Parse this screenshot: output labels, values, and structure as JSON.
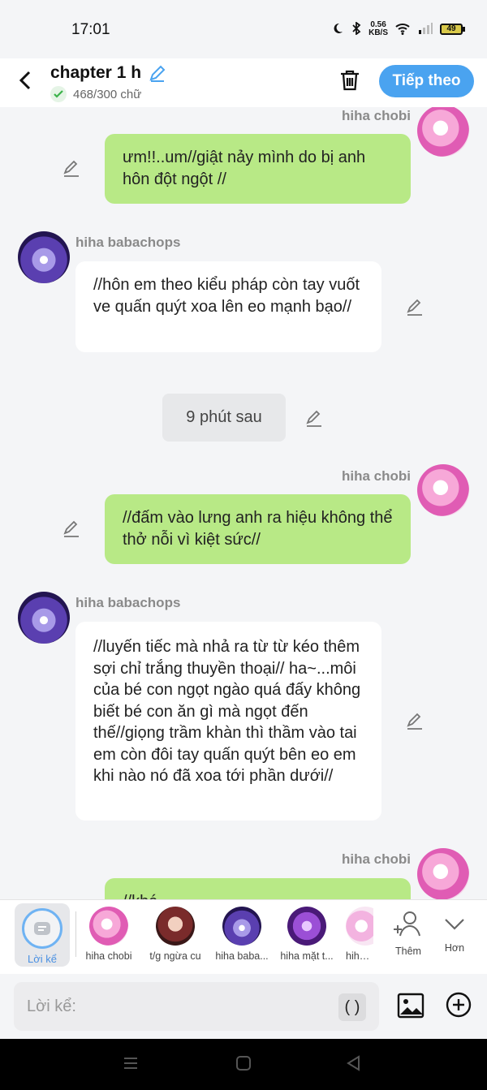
{
  "status": {
    "time": "17:01",
    "speed_top": "0.56",
    "speed_unit": "KB/S",
    "battery": "49"
  },
  "header": {
    "title": "chapter 1 h",
    "counter": "468/300 chữ",
    "next_label": "Tiếp theo"
  },
  "messages": [
    {
      "sender": "hiha chobi",
      "text": "ưm!!..um//giật nảy mình do bị anh hôn đột ngột //"
    },
    {
      "sender": "hiha babachops",
      "text": "//hôn em theo kiểu pháp còn tay vuốt ve quấn quýt xoa lên eo mạnh bạo//"
    },
    {
      "sender": "hiha chobi",
      "text": "//đấm vào lưng anh ra hiệu không thể thở nỗi vì kiệt sức//"
    },
    {
      "sender": "hiha babachops",
      "text": "//luyến tiếc mà nhả ra từ từ kéo thêm sợi chỉ trắng thuyền thoại// ha~...môi của bé con ngọt ngào quá đấy không biết bé con ăn gì mà ngọt đến thế//giọng trầm khàn thì thầm vào tai em còn đôi tay quấn quýt bên eo em khi nào nó đã xoa tới phần dưới//"
    },
    {
      "sender": "hiha chobi",
      "text": "//khá..."
    }
  ],
  "time_chip": "9 phút sau",
  "charbar": {
    "narrator": "Lời kể",
    "characters": [
      "hiha chobi",
      "t/g ngừa cu",
      "hiha baba...",
      "hiha mặt t...",
      "hiha k"
    ],
    "add_label": "Thêm",
    "more_label": "Hơn"
  },
  "input": {
    "placeholder": "Lời kể:",
    "paren": "( )"
  },
  "colors": {
    "accent": "#4aa3f0",
    "bubble_green": "#b8e986",
    "bubble_white": "#ffffff",
    "background": "#f4f5f7"
  }
}
